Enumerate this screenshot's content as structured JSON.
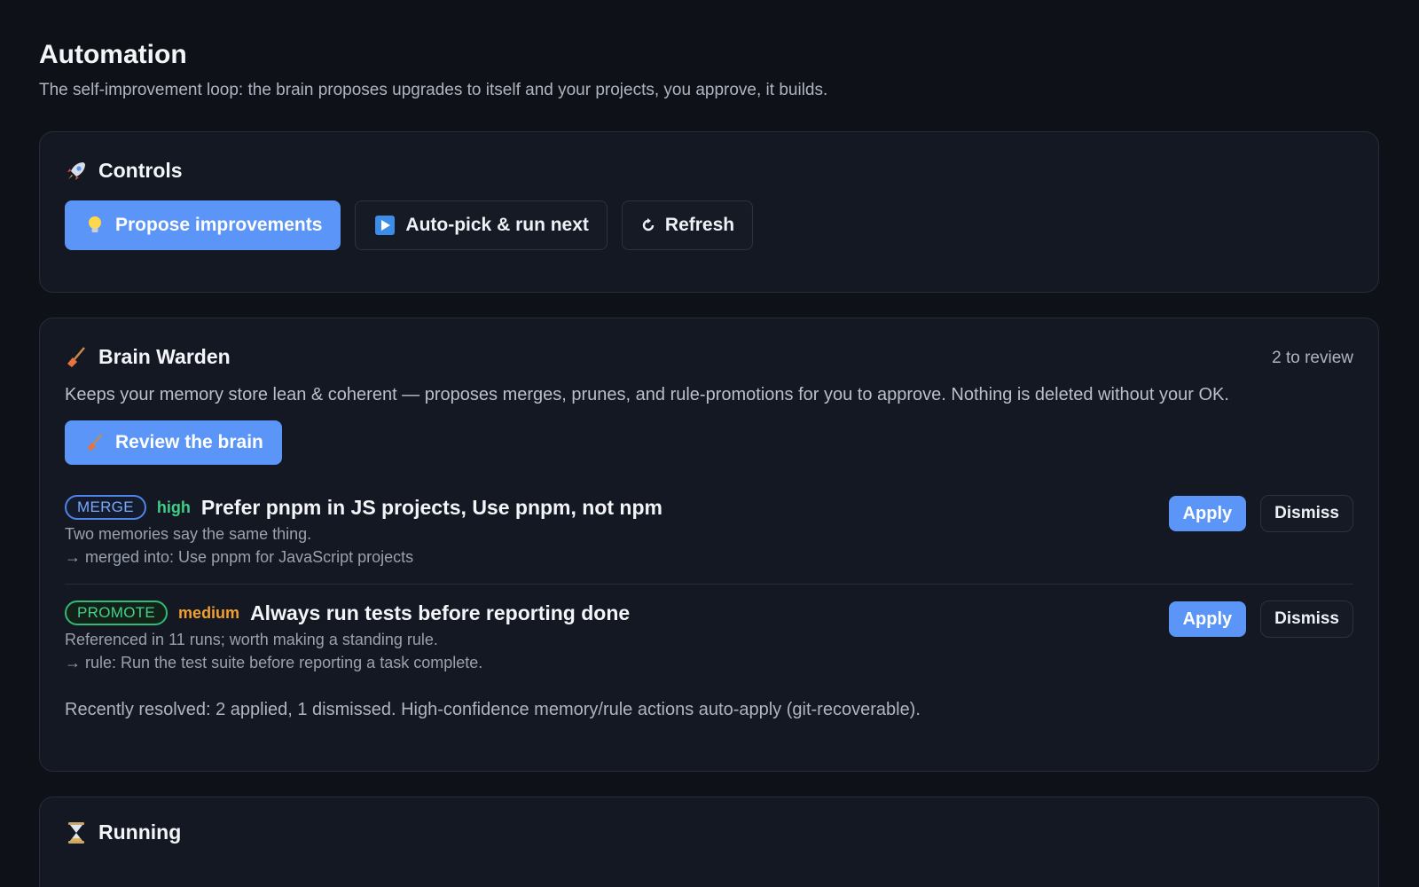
{
  "page": {
    "title": "Automation",
    "subtitle": "The self-improvement loop: the brain proposes upgrades to itself and your projects, you approve, it builds."
  },
  "controls": {
    "title": "Controls",
    "icon": "rocket-icon",
    "propose_label": "Propose improvements",
    "propose_icon": "lightbulb-icon",
    "autopick_label": "Auto-pick & run next",
    "autopick_icon": "play-icon",
    "refresh_label": "Refresh",
    "refresh_icon": "refresh-icon"
  },
  "warden": {
    "title": "Brain Warden",
    "icon": "broom-icon",
    "review_count": "2 to review",
    "description": "Keeps your memory store lean & coherent — proposes merges, prunes, and rule-promotions for you to approve. Nothing is deleted without your OK.",
    "review_button_label": "Review the brain",
    "proposals": [
      {
        "type": "MERGE",
        "confidence": "high",
        "title": "Prefer pnpm in JS projects, Use pnpm, not npm",
        "reason": "Two memories say the same thing.",
        "result": "→ merged into: Use pnpm for JavaScript projects",
        "apply_label": "Apply",
        "dismiss_label": "Dismiss"
      },
      {
        "type": "PROMOTE",
        "confidence": "medium",
        "title": "Always run tests before reporting done",
        "reason": "Referenced in 11 runs; worth making a standing rule.",
        "result": "→ rule: Run the test suite before reporting a task complete.",
        "apply_label": "Apply",
        "dismiss_label": "Dismiss"
      }
    ],
    "resolved_text": "Recently resolved: 2 applied, 1 dismissed. High-confidence memory/rule actions auto-apply (git-recoverable)."
  },
  "running": {
    "title": "Running",
    "icon": "hourglass-icon"
  },
  "colors": {
    "background": "#0e1117",
    "card": "#141822",
    "accent": "#5b95f7",
    "merge": "#79a8ff",
    "promote": "#47d08c",
    "high": "#3ecf86",
    "medium": "#f0a030"
  }
}
